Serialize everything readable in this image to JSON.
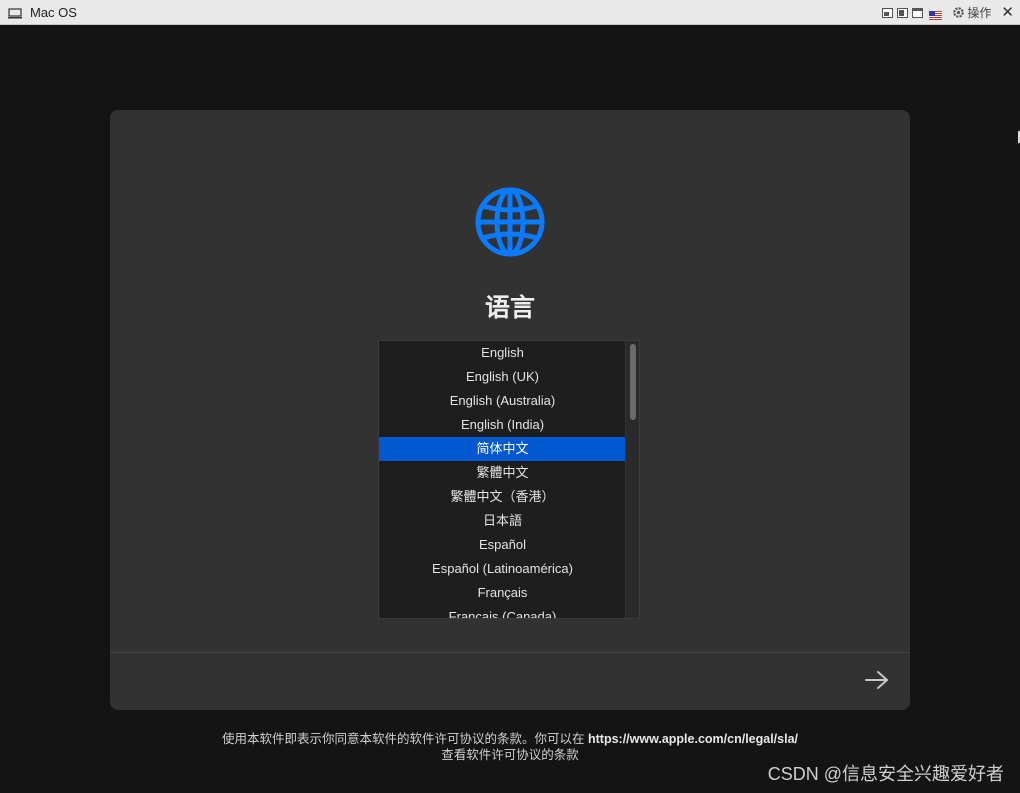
{
  "host": {
    "title": "Mac OS",
    "ops_label": "操作"
  },
  "dialog": {
    "title": "语言",
    "languages": [
      "English",
      "English (UK)",
      "English (Australia)",
      "English (India)",
      "简体中文",
      "繁體中文",
      "繁體中文（香港）",
      "日本語",
      "Español",
      "Español (Latinoamérica)",
      "Français",
      "Français (Canada)"
    ],
    "selected_language": "简体中文"
  },
  "footer": {
    "license_line1_prefix": "使用本软件即表示你同意本软件的软件许可协议的条款。你可以在",
    "license_link": "https://www.apple.com/cn/legal/sla/",
    "license_line2": "查看软件许可协议的条款"
  },
  "watermark": "CSDN @信息安全兴趣爱好者",
  "colors": {
    "accent": "#0a7aff",
    "selection": "#0058d0",
    "background": "#141414",
    "panel": "#323232"
  },
  "icons": {
    "globe": "globe-icon",
    "next": "arrow-right-icon",
    "settings": "gear-icon",
    "close": "close-icon"
  }
}
